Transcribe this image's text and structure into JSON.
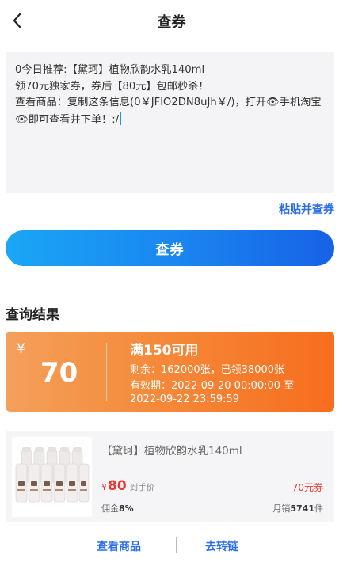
{
  "header": {
    "title": "查券"
  },
  "input": {
    "text_line1": "0今日推荐:【黛珂】植物欣韵水乳140ml",
    "text_line2": "领70元独家券，券后【80元】包邮秒杀！",
    "text_line3": "查看商品：复制这条信息(0￥JFlO2DN8uJh￥/)，打开👁手机淘宝👁即可查看并下单！:/"
  },
  "actions": {
    "paste_query": "粘贴并查券",
    "query_button": "查券"
  },
  "results": {
    "title": "查询结果",
    "coupon": {
      "currency": "¥",
      "amount": "70",
      "condition": "满150可用",
      "stock": "剩余：162000张，已领38000张",
      "valid_line1": "有效期：2022-09-20 00:00:00 至",
      "valid_line2": "2022-09-22 23:59:59"
    },
    "product": {
      "name": "【黛珂】植物欣韵水乳140ml",
      "price_symbol": "¥",
      "price": "80",
      "price_label": "到手价",
      "coupon_tag": "70元券",
      "commission_label": "佣金",
      "commission_value": "8%",
      "sales_label": "月销",
      "sales_value": "5741",
      "sales_unit": "件"
    }
  },
  "bottom": {
    "view_goods": "查看商品",
    "convert": "去转链"
  },
  "colors": {
    "accent_blue": "#2f6fe8",
    "coupon_orange": "#f76d1e",
    "price_red": "#e8392c"
  },
  "icons": {
    "back": "chevron-left-icon",
    "product_image": "product-thumbnail"
  }
}
